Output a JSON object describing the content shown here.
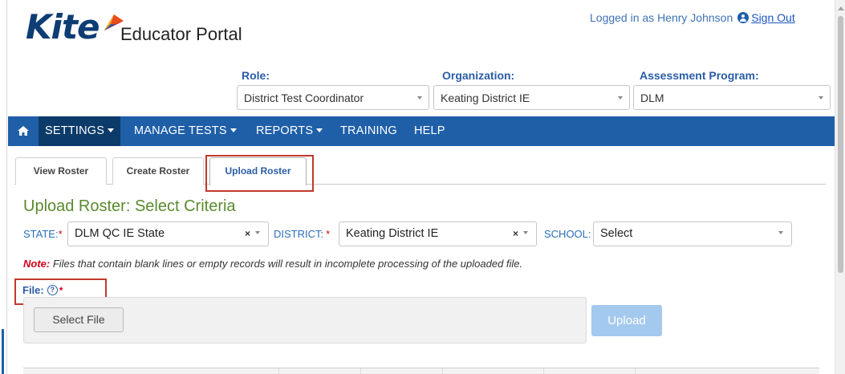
{
  "header": {
    "logo_text": "Kite",
    "portal_title": "Educator Portal",
    "logged_in_text": "Logged in as Henry Johnson",
    "sign_out_label": "Sign Out"
  },
  "selectors": {
    "role": {
      "label": "Role:",
      "value": "District Test Coordinator"
    },
    "organization": {
      "label": "Organization:",
      "value": "Keating District IE"
    },
    "assessment_program": {
      "label": "Assessment Program:",
      "value": "DLM"
    }
  },
  "nav": {
    "home_icon": "home-icon",
    "items": [
      {
        "label": "SETTINGS",
        "dropdown": true,
        "active": true
      },
      {
        "label": "MANAGE TESTS",
        "dropdown": true
      },
      {
        "label": "REPORTS",
        "dropdown": true
      },
      {
        "label": "TRAINING",
        "dropdown": false
      },
      {
        "label": "HELP",
        "dropdown": false
      }
    ]
  },
  "tabs": [
    {
      "label": "View Roster"
    },
    {
      "label": "Create Roster"
    },
    {
      "label": "Upload Roster",
      "active": true
    }
  ],
  "main": {
    "section_title": "Upload Roster: Select Criteria",
    "criteria": {
      "state": {
        "label": "STATE:",
        "required": "*",
        "value": "DLM QC IE State"
      },
      "district": {
        "label": "DISTRICT:",
        "required": "*",
        "value": "Keating District IE"
      },
      "school": {
        "label": "SCHOOL:",
        "value": "Select"
      }
    },
    "note_label": "Note:",
    "note_text": "Files that contain blank lines or empty records will result in incomplete processing of the uploaded file.",
    "file_label": "File:",
    "file_help": "?",
    "file_required": "*",
    "select_file_label": "Select File",
    "upload_label": "Upload"
  },
  "colors": {
    "navbar": "#1f5fa8",
    "nav_active": "#0c3a69",
    "section_title": "#5a8a2e",
    "highlight": "#c0392b",
    "upload_disabled": "#a4c9ef"
  }
}
